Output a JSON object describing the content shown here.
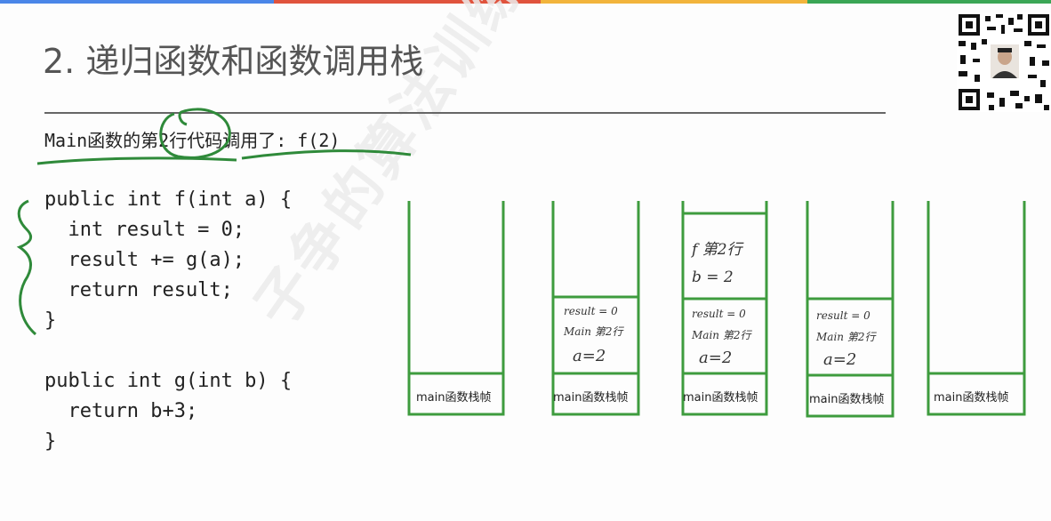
{
  "top_bar_colors": [
    "#4a86e8",
    "#e0533d",
    "#f2b43c",
    "#3aa655"
  ],
  "slide": {
    "title": "2. 递归函数和函数调用栈",
    "subtitle": "Main函数的第2行代码调用了: f(2)"
  },
  "code": {
    "lines": [
      "public int f(int a) {",
      "  int result = 0;",
      "  result += g(a);",
      "  return result;",
      "}",
      "",
      "public int g(int b) {",
      "  return b+3;",
      "}"
    ]
  },
  "stacks": {
    "stack1": {
      "main_label": "main函数栈帧"
    },
    "stack2": {
      "main_label": "main函数栈帧",
      "frame_line1": "result = 0",
      "frame_line2": "Main 第2行",
      "frame_line3": "a=2"
    },
    "stack3": {
      "main_label": "main函数栈帧",
      "frame_line1": "result = 0",
      "frame_line2": "Main 第2行",
      "frame_line3": "a=2",
      "top_line1": "f 第2行",
      "top_line2": "b = 2"
    },
    "stack4": {
      "main_label": "main函数栈帧",
      "frame_line1": "result = 0",
      "frame_line2": "Main 第2行",
      "frame_line3": "a=2"
    },
    "stack5": {
      "main_label": "main函数栈帧"
    }
  },
  "colors": {
    "stack_green": "#3e9c3e",
    "annotation_green": "#2f8a3a",
    "title_gray": "#555555"
  },
  "icons": {
    "qr": "qr-code-icon"
  },
  "watermark": "子争的算法训练营"
}
